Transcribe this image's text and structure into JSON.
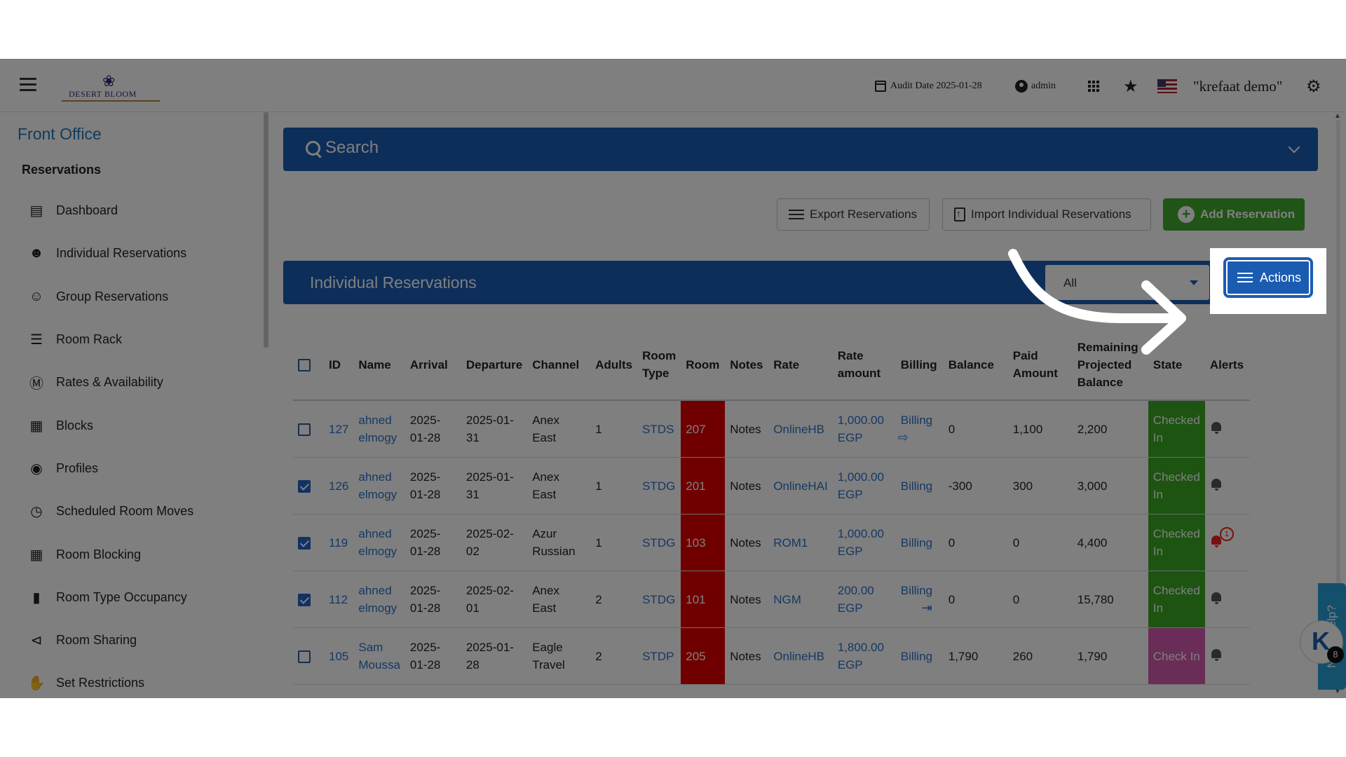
{
  "topbar": {
    "audit_label": "Audit Date 2025-01-28",
    "user": "admin",
    "org": "\"krefaat demo\"",
    "logo_text": "DESERT BLOOM"
  },
  "sidebar": {
    "title": "Front Office",
    "section": "Reservations",
    "items": [
      {
        "label": "Dashboard",
        "icon": "bar-chart-icon"
      },
      {
        "label": "Individual Reservations",
        "icon": "person-icon"
      },
      {
        "label": "Group Reservations",
        "icon": "people-icon"
      },
      {
        "label": "Room Rack",
        "icon": "list-icon"
      },
      {
        "label": "Rates & Availability",
        "icon": "dollar-icon"
      },
      {
        "label": "Blocks",
        "icon": "dashboard-tiles-icon"
      },
      {
        "label": "Profiles",
        "icon": "account-circle-icon"
      },
      {
        "label": "Scheduled Room Moves",
        "icon": "clock-icon"
      },
      {
        "label": "Room Blocking",
        "icon": "grid-icon"
      },
      {
        "label": "Room Type Occupancy",
        "icon": "label-icon"
      },
      {
        "label": "Room Sharing",
        "icon": "share-icon"
      },
      {
        "label": "Set Restrictions",
        "icon": "hand-icon"
      }
    ]
  },
  "search": {
    "label": "Search"
  },
  "toolbar": {
    "export_label": "Export Reservations",
    "import_label": "Import Individual Reservations",
    "add_label": "Add Reservation"
  },
  "reservations": {
    "title": "Individual Reservations",
    "filter_value": "All",
    "actions_label": "Actions"
  },
  "table": {
    "headers": [
      "ID",
      "Name",
      "Arrival",
      "Departure",
      "Channel",
      "Adults",
      "Room Type",
      "Room",
      "Notes",
      "Rate",
      "Rate amount",
      "Billing",
      "Balance",
      "Paid Amount",
      "Remaining Projected Balance",
      "State",
      "Alerts"
    ],
    "rows": [
      {
        "checked": false,
        "id": "127",
        "name": "ahned elmogy",
        "arrival": "2025-01-28",
        "departure": "2025-01-31",
        "channel": "Anex East",
        "adults": "1",
        "room_type": "STDS",
        "room": "207",
        "notes": "Notes",
        "rate": "OnlineHB",
        "rate_amount": "1,000.00 EGP",
        "billing": "Billing",
        "balance": "0",
        "paid": "1,100",
        "remaining": "2,200",
        "state": "Checked In",
        "state_color": "#3aa825",
        "alert_badge": ""
      },
      {
        "checked": true,
        "id": "126",
        "name": "ahned elmogy",
        "arrival": "2025-01-28",
        "departure": "2025-01-31",
        "channel": "Anex East",
        "adults": "1",
        "room_type": "STDG",
        "room": "201",
        "notes": "Notes",
        "rate": "OnlineHAI",
        "rate_amount": "1,000.00 EGP",
        "billing": "Billing",
        "balance": "-300",
        "paid": "300",
        "remaining": "3,000",
        "state": "Checked In",
        "state_color": "#3aa825",
        "alert_badge": ""
      },
      {
        "checked": true,
        "id": "119",
        "name": "ahned elmogy",
        "arrival": "2025-01-28",
        "departure": "2025-02-02",
        "channel": "Azur Russian",
        "adults": "1",
        "room_type": "STDG",
        "room": "103",
        "notes": "Notes",
        "rate": "ROM1",
        "rate_amount": "1,000.00 EGP",
        "billing": "Billing",
        "balance": "0",
        "paid": "0",
        "remaining": "4,400",
        "state": "Checked In",
        "state_color": "#3aa825",
        "alert_badge": "1"
      },
      {
        "checked": true,
        "id": "112",
        "name": "ahned elmogy",
        "arrival": "2025-01-28",
        "departure": "2025-02-01",
        "channel": "Anex East",
        "adults": "2",
        "room_type": "STDG",
        "room": "101",
        "notes": "Notes",
        "rate": "NGM",
        "rate_amount": "200.00 EGP",
        "billing": "Billing",
        "balance": "0",
        "paid": "0",
        "remaining": "15,780",
        "state": "Checked In",
        "state_color": "#3aa825",
        "alert_badge": ""
      },
      {
        "checked": false,
        "id": "105",
        "name": "Sam Moussa",
        "arrival": "2025-01-28",
        "departure": "2025-01-28",
        "channel": "Eagle Travel",
        "adults": "2",
        "room_type": "STDP",
        "room": "205",
        "notes": "Notes",
        "rate": "OnlineHB",
        "rate_amount": "1,800.00 EGP",
        "billing": "Billing",
        "balance": "1,790",
        "paid": "260",
        "remaining": "1,790",
        "state": "Check In",
        "state_color": "#d25ab0",
        "alert_badge": ""
      }
    ]
  },
  "help": {
    "label": "Need Help?",
    "k_letter": "K",
    "notification_count": "8"
  },
  "colors": {
    "primary": "#1b5cb3",
    "success": "#43a92f",
    "room_occupied": "#e00000",
    "link": "#2a72c9"
  }
}
